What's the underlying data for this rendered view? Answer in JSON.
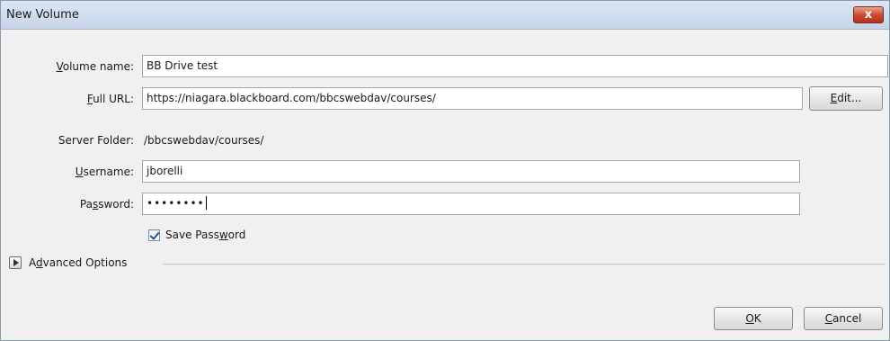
{
  "window": {
    "title": "New Volume",
    "close_label": "x"
  },
  "form": {
    "volume_name": {
      "label": "Volume name:",
      "mnemonic": "V",
      "value": "BB Drive test"
    },
    "full_url": {
      "label": "Full URL:",
      "mnemonic": "F",
      "value": "https://niagara.blackboard.com/bbcswebdav/courses/"
    },
    "edit_button": {
      "label": "Edit...",
      "mnemonic": "E"
    },
    "server_folder": {
      "label": "Server Folder:",
      "value": "/bbcswebdav/courses/"
    },
    "username": {
      "label": "Username:",
      "mnemonic": "U",
      "value": "jborelli"
    },
    "password": {
      "label": "Password:",
      "mnemonic": "s",
      "value": "••••••••"
    },
    "save_password": {
      "label": "Save Password",
      "mnemonic": "w",
      "checked": true
    }
  },
  "advanced": {
    "label": "Advanced Options",
    "mnemonic": "d",
    "expanded": false
  },
  "buttons": {
    "ok": {
      "label": "OK",
      "mnemonic": "O"
    },
    "cancel": {
      "label": "Cancel",
      "mnemonic": "C"
    }
  }
}
